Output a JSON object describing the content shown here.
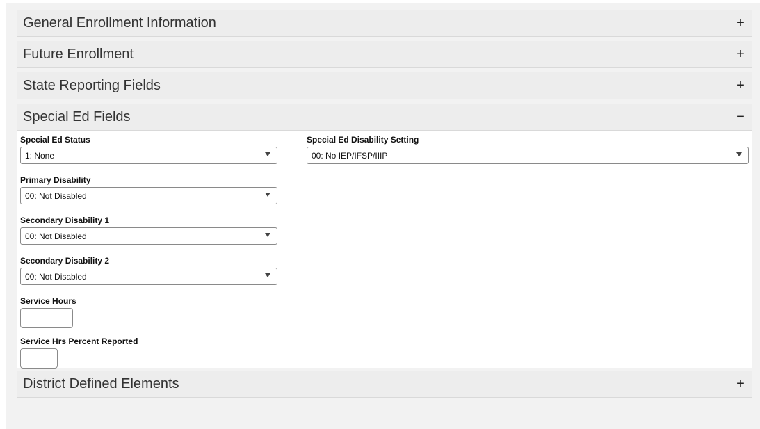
{
  "panels": {
    "general": {
      "title": "General Enrollment Information",
      "toggle": "+"
    },
    "future": {
      "title": "Future Enrollment",
      "toggle": "+"
    },
    "state": {
      "title": "State Reporting Fields",
      "toggle": "+"
    },
    "special_ed": {
      "title": "Special Ed Fields",
      "toggle": "−",
      "fields": {
        "status": {
          "label": "Special Ed Status",
          "value": "1: None"
        },
        "disability_setting": {
          "label": "Special Ed Disability Setting",
          "value": "00: No IEP/IFSP/IIIP"
        },
        "primary_disability": {
          "label": "Primary Disability",
          "value": "00: Not Disabled"
        },
        "secondary_disability_1": {
          "label": "Secondary Disability 1",
          "value": "00: Not Disabled"
        },
        "secondary_disability_2": {
          "label": "Secondary Disability 2",
          "value": "00: Not Disabled"
        },
        "service_hours": {
          "label": "Service Hours",
          "value": ""
        },
        "service_hrs_percent": {
          "label": "Service Hrs Percent Reported",
          "value": ""
        }
      }
    },
    "district": {
      "title": "District Defined Elements",
      "toggle": "+"
    }
  }
}
